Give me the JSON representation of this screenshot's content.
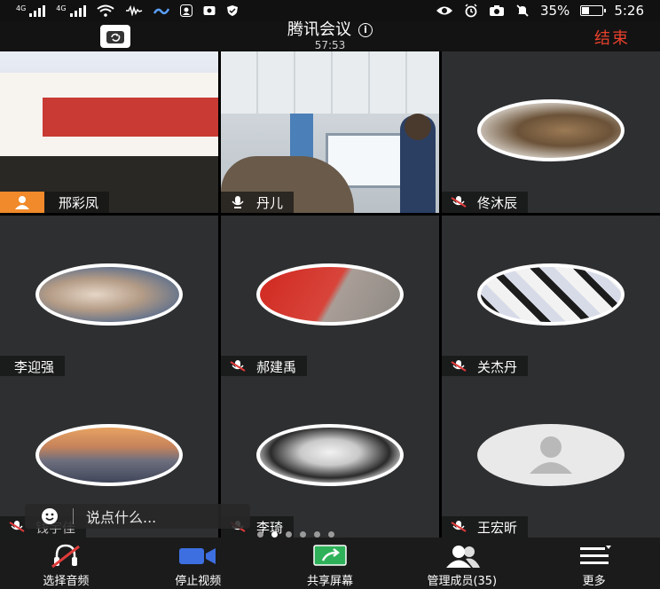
{
  "status_bar": {
    "network_1": "4G",
    "network_2": "4G",
    "battery": "35%",
    "battery_level": 0.35,
    "time": "5:26"
  },
  "header": {
    "title": "腾讯会议",
    "timer": "57:53",
    "end_label": "结束",
    "end_color": "#e8412c"
  },
  "participants": [
    {
      "name": "邢彩凤"
    },
    {
      "name": "丹儿"
    },
    {
      "name": "佟沐辰"
    },
    {
      "name": "李迎强"
    },
    {
      "name": "郝建禹"
    },
    {
      "name": "关杰丹"
    },
    {
      "name": "钱宇佳"
    },
    {
      "name": "李琦"
    },
    {
      "name": "王宏昕"
    }
  ],
  "chat": {
    "placeholder": "说点什么..."
  },
  "toolbar": {
    "audio": "选择音频",
    "video": "停止视频",
    "share": "共享屏幕",
    "members": "管理成员(35)",
    "more": "更多"
  },
  "colors": {
    "active_border": "#2faa46",
    "presenter": "#f08a2a",
    "muted": "#e03b3b",
    "video_icon": "#3d6fe0",
    "share_icon": "#2fb15a"
  }
}
